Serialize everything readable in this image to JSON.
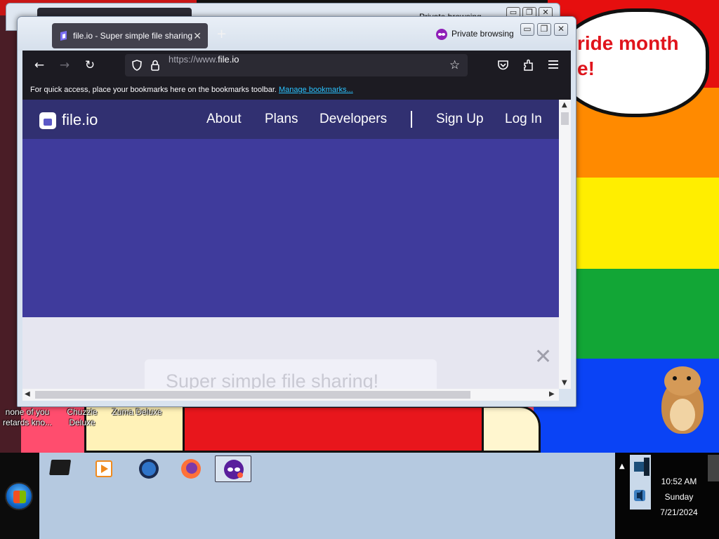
{
  "wallpaper": {
    "bubble_text": "ride month\ne!"
  },
  "desktop_icons": [
    {
      "label": "none of you retards kno..."
    },
    {
      "label": "Chuzzle Deluxe"
    },
    {
      "label": "Zuma Deluxe"
    }
  ],
  "bg_window": {
    "private_label": "Private browsing"
  },
  "browser": {
    "tab_title": "file.io - Super simple file sharing",
    "tab_close": "✕",
    "new_tab": "+",
    "private_label": "Private browsing",
    "controls": {
      "minimize": "▭",
      "maximize": "❐",
      "close": "✕"
    },
    "nav": {
      "back": "←",
      "forward": "→",
      "reload": "↻"
    },
    "url_prefix": "https://www.",
    "url_domain": "file.io",
    "star": "☆",
    "bookmarks_notice": "For quick access, place your bookmarks here on the bookmarks toolbar.",
    "manage_bookmarks": "Manage bookmarks..."
  },
  "site": {
    "logo_text": "file.io",
    "nav": {
      "about": "About",
      "plans": "Plans",
      "developers": "Developers",
      "sign_up": "Sign Up",
      "log_in": "Log In"
    },
    "card_title": "Super simple file sharing!",
    "overlay_close": "✕"
  },
  "scrollbars": {
    "up": "▲",
    "down": "▼",
    "left": "◀",
    "right": "▶"
  },
  "taskbar": {
    "tray_chevron": "▲",
    "time": "10:52 AM",
    "day": "Sunday",
    "date": "7/21/2024"
  },
  "colors": {
    "site_header": "#313071",
    "hero": "#3f3b9c",
    "link": "#2ac3ff"
  }
}
